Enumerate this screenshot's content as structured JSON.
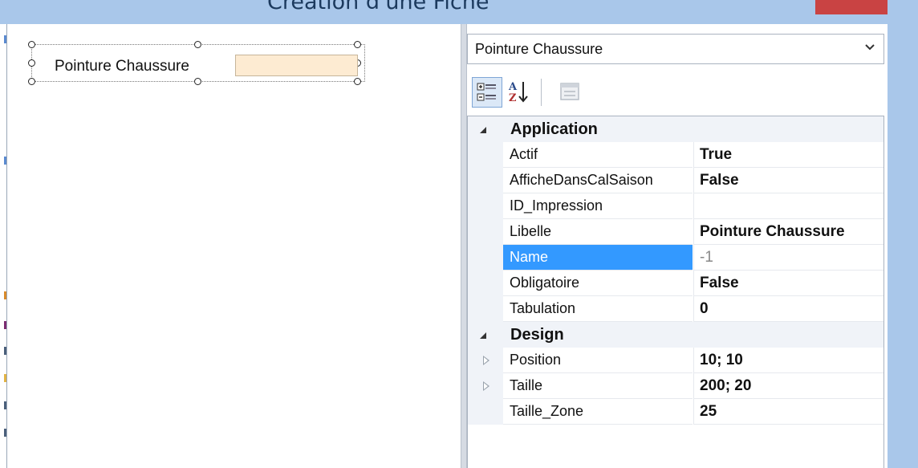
{
  "window": {
    "title": "Création d'une Fiche"
  },
  "designer": {
    "field_label": "Pointure Chaussure",
    "field_value": ""
  },
  "property_panel": {
    "selected_object": "Pointure Chaussure",
    "categories": [
      {
        "name": "Application",
        "properties": [
          {
            "name": "Actif",
            "value": "True"
          },
          {
            "name": "AfficheDansCalSaison",
            "value": "False"
          },
          {
            "name": "ID_Impression",
            "value": ""
          },
          {
            "name": "Libelle",
            "value": "Pointure Chaussure"
          },
          {
            "name": "Name",
            "value": "-1",
            "selected": true
          },
          {
            "name": "Obligatoire",
            "value": "False"
          },
          {
            "name": "Tabulation",
            "value": "0"
          }
        ]
      },
      {
        "name": "Design",
        "properties": [
          {
            "name": "Position",
            "value": "10; 10",
            "expandable": true
          },
          {
            "name": "Taille",
            "value": "200; 20",
            "expandable": true
          },
          {
            "name": "Taille_Zone",
            "value": "25"
          }
        ]
      }
    ]
  },
  "icons": {
    "categorized": "categorized-view-icon",
    "alphabetical": "sort-az-icon",
    "property_pages": "property-pages-icon",
    "dropdown": "chevron-down-icon",
    "collapse": "collapse-triangle-icon",
    "expand": "expand-triangle-icon"
  },
  "colors": {
    "title_bar": "#a9c7ea",
    "close_button": "#c94343",
    "selection": "#3399ff",
    "input_background": "#fdebd2"
  }
}
